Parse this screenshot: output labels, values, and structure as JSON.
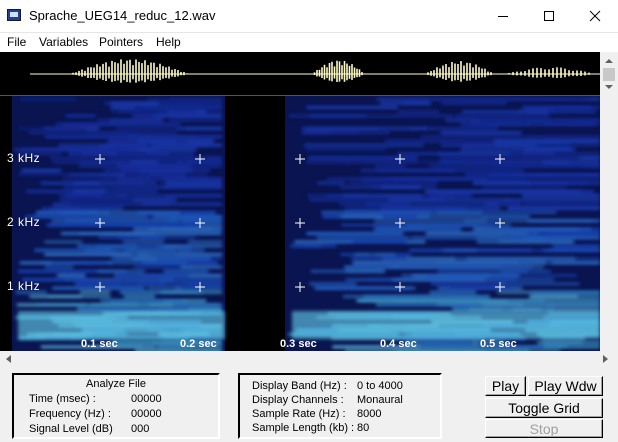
{
  "window": {
    "title": "Sprache_UEG14_reduc_12.wav"
  },
  "menu": [
    "File",
    "Variables",
    "Pointers",
    "Help"
  ],
  "spectrogram": {
    "frequency_labels": [
      "3 kHz",
      "2 kHz",
      "1 kHz"
    ],
    "time_labels": [
      "0.1 sec",
      "0.2 sec",
      "0.3 sec",
      "0.4 sec",
      "0.5 sec"
    ]
  },
  "analyze": {
    "heading": "Analyze File",
    "rows": [
      {
        "label": "Time (msec) :",
        "value": "00000"
      },
      {
        "label": "Frequency (Hz) :",
        "value": "00000"
      },
      {
        "label": "Signal Level (dB)",
        "value": "000"
      }
    ]
  },
  "info": {
    "rows": [
      {
        "label": "Display Band (Hz) :",
        "value": "0 to 4000"
      },
      {
        "label": "Display Channels :",
        "value": "Monaural"
      },
      {
        "label": "Sample Rate (Hz) :",
        "value": "8000"
      },
      {
        "label": "Sample Length (kb) :",
        "value": "80"
      }
    ]
  },
  "buttons": {
    "play": "Play",
    "play_window": "Play Wdw",
    "toggle_grid": "Toggle Grid",
    "stop": "Stop"
  },
  "colors": {
    "spectrogram_background": "#000000",
    "waveform": "#fffcc8",
    "grid_marker": "#ffffff",
    "separator": "#2a54c8"
  },
  "icons": {
    "app": "wave-app-icon",
    "minimize": "minimize-icon",
    "maximize": "maximize-icon",
    "close": "close-icon"
  }
}
